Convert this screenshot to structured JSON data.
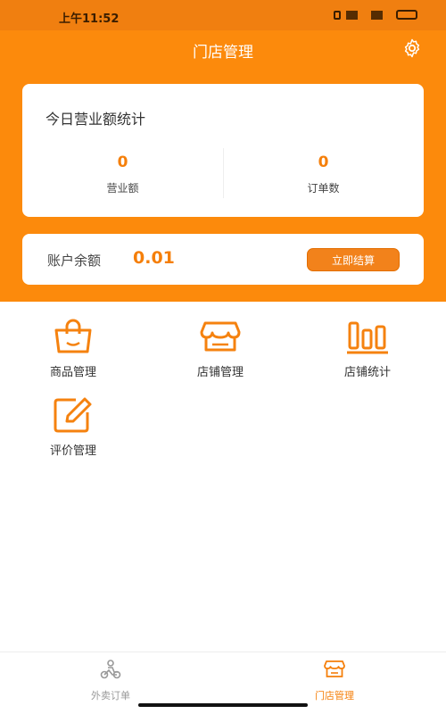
{
  "status_bar": {
    "time": "上午11:52"
  },
  "header": {
    "title": "门店管理"
  },
  "stats": {
    "title": "今日营业额统计",
    "items": [
      {
        "value": "0",
        "label": "营业额"
      },
      {
        "value": "0",
        "label": "订单数"
      }
    ]
  },
  "balance": {
    "label": "账户余额",
    "value": "0.01",
    "button": "立即结算"
  },
  "grid": [
    {
      "label": "商品管理",
      "icon": "shopping-bag-icon"
    },
    {
      "label": "店铺管理",
      "icon": "store-icon"
    },
    {
      "label": "店铺统计",
      "icon": "bar-chart-icon"
    },
    {
      "label": "评价管理",
      "icon": "edit-icon"
    }
  ],
  "tabbar": [
    {
      "label": "外卖订单",
      "icon": "delivery-rider-icon",
      "active": false
    },
    {
      "label": "门店管理",
      "icon": "store-icon",
      "active": true
    }
  ],
  "colors": {
    "accent": "#fc8a0c",
    "accent_text": "#f57f0a",
    "button": "#f2821b"
  }
}
